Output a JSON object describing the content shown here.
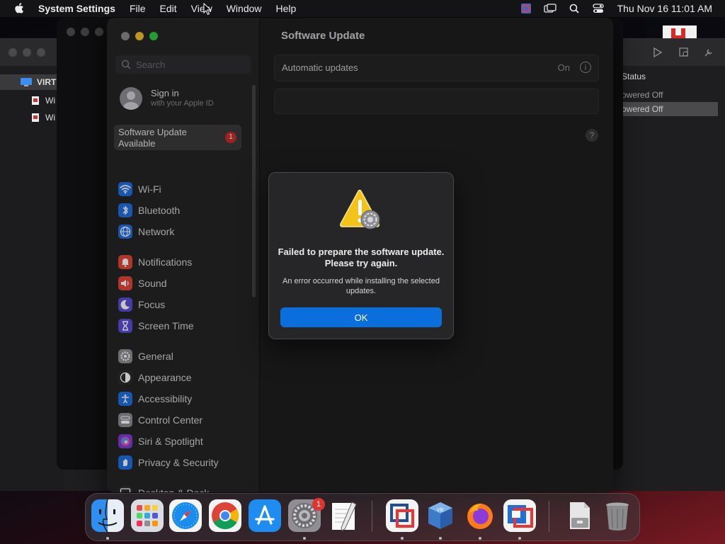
{
  "menubar": {
    "app_name": "System Settings",
    "menus": [
      "File",
      "Edit",
      "View",
      "Window",
      "Help"
    ],
    "clock": "Thu Nov 16  11:01 AM"
  },
  "background_vm_manager": {
    "sidebar_items": [
      "VIRT",
      "Wi",
      "Wi"
    ],
    "status_header": "Status",
    "status_values": [
      "owered Off",
      "owered Off"
    ]
  },
  "settings": {
    "search_placeholder": "Search",
    "signin": {
      "title": "Sign in",
      "subtitle": "with your Apple ID"
    },
    "update_available": {
      "label": "Software Update Available",
      "badge": "1"
    },
    "sidebar_items": [
      {
        "label": "Wi-Fi",
        "icon": "wifi-icon",
        "color": "#1f6fe0"
      },
      {
        "label": "Bluetooth",
        "icon": "bluetooth-icon",
        "color": "#1f6fe0"
      },
      {
        "label": "Network",
        "icon": "globe-icon",
        "color": "#1f6fe0"
      },
      {
        "label": "Notifications",
        "icon": "bell-icon",
        "color": "#e0443a"
      },
      {
        "label": "Sound",
        "icon": "speaker-icon",
        "color": "#e0443a"
      },
      {
        "label": "Focus",
        "icon": "moon-icon",
        "color": "#5b4cd6"
      },
      {
        "label": "Screen Time",
        "icon": "hourglass-icon",
        "color": "#5b4cd6"
      },
      {
        "label": "General",
        "icon": "gear-icon",
        "color": "#8e8e93"
      },
      {
        "label": "Appearance",
        "icon": "appearance-icon",
        "color": "#2c2c2e"
      },
      {
        "label": "Accessibility",
        "icon": "accessibility-icon",
        "color": "#1f6fe0"
      },
      {
        "label": "Control Center",
        "icon": "control-center-icon",
        "color": "#8e8e93"
      },
      {
        "label": "Siri & Spotlight",
        "icon": "siri-icon",
        "color": "#7a3fd6"
      },
      {
        "label": "Privacy & Security",
        "icon": "hand-icon",
        "color": "#1f6fe0"
      },
      {
        "label": "Desktop & Dock",
        "icon": "dock-icon",
        "color": "#2c2c2e"
      }
    ],
    "content": {
      "title": "Software Update",
      "automatic_updates_label": "Automatic updates",
      "automatic_updates_value": "On",
      "help": "?"
    }
  },
  "alert": {
    "title": "Failed to prepare the software update. Please try again.",
    "message": "An error occurred while installing the selected updates.",
    "ok_label": "OK"
  },
  "dock": {
    "apps": [
      "finder",
      "launchpad",
      "safari",
      "chrome",
      "app-store",
      "system-settings",
      "textedit",
      "vmware-fusion",
      "virtualbox",
      "firefox",
      "parallels",
      "archive-utility",
      "trash"
    ],
    "system_settings_badge": "1"
  }
}
